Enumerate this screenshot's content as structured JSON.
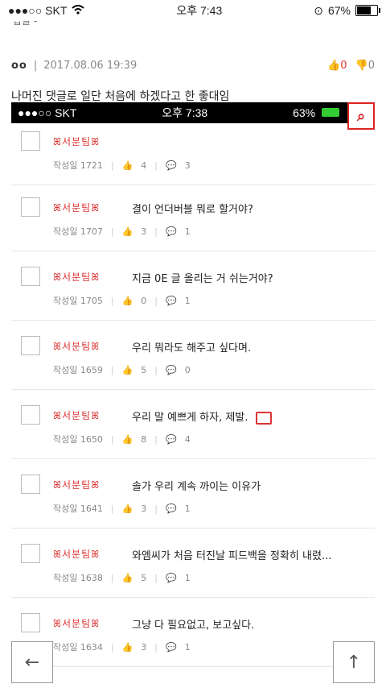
{
  "status": {
    "carrier": "●●●○○ SKT",
    "wifi": "wifi-icon",
    "time": "오후 7:43",
    "lock_icon": "rotation-lock-icon",
    "battery": "67%"
  },
  "cut_text": "답글 -",
  "comment": {
    "nick": "oo",
    "datetime": "2017.08.06 19:39",
    "upvotes": "0",
    "downvotes": "0",
    "text": "나머진 댓글로 일단 처음에 하겠다고 한 좋대임"
  },
  "inner": {
    "status": {
      "carrier": "●●●○○ SKT",
      "time": "오후 7:38",
      "battery": "63%"
    },
    "rows": [
      {
        "brand": "ꕤ서분팀ꕤ",
        "title": "",
        "written": "작성일 1721",
        "likes": "4",
        "comments": "3",
        "image": false
      },
      {
        "brand": "ꕤ서분팀ꕤ",
        "title": "결이 언더버블 뭐로 할거야?",
        "written": "작성일 1707",
        "likes": "3",
        "comments": "1",
        "image": false
      },
      {
        "brand": "ꕤ서분팀ꕤ",
        "title": "지금 0E 글 올리는 거 쉬는거야?",
        "written": "작성일 1705",
        "likes": "0",
        "comments": "1",
        "image": false
      },
      {
        "brand": "ꕤ서분팀ꕤ",
        "title": "우리 뭐라도 해주고 싶다며.",
        "written": "작성일 1659",
        "likes": "5",
        "comments": "0",
        "image": false
      },
      {
        "brand": "ꕤ서분팀ꕤ",
        "title": "우리 말 예쁘게 하자, 제발.",
        "written": "작성일 1650",
        "likes": "8",
        "comments": "4",
        "image": true
      },
      {
        "brand": "ꕤ서분팀ꕤ",
        "title": "솔가 우리 계속 까이는 이유가",
        "written": "작성일 1641",
        "likes": "3",
        "comments": "1",
        "image": false
      },
      {
        "brand": "ꕤ서분팀ꕤ",
        "title": "와엠씨가 처음 터진날 피드백을 정확히 내렸...",
        "written": "작성일 1638",
        "likes": "5",
        "comments": "1",
        "image": false
      },
      {
        "brand": "ꕤ서분팀ꕤ",
        "title": "그냥 다 필요없고, 보고싶다.",
        "written": "작성일 1634",
        "likes": "3",
        "comments": "1",
        "image": false
      }
    ]
  },
  "nav": {
    "back": "←",
    "top": "↑"
  },
  "colors": {
    "accent": "#dd3333"
  }
}
